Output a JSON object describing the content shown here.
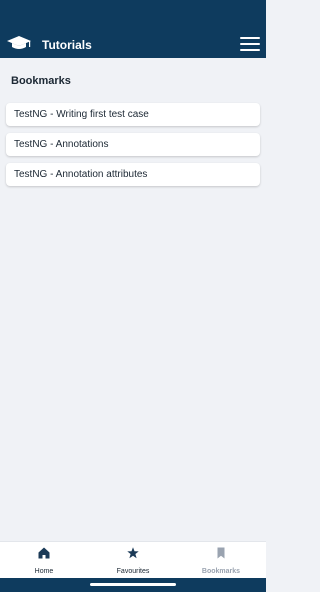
{
  "header": {
    "title": "Tutorials"
  },
  "page": {
    "title": "Bookmarks"
  },
  "bookmarks": [
    "TestNG - Writing first test case",
    "TestNG - Annotations",
    "TestNG - Annotation attributes"
  ],
  "nav": {
    "items": [
      {
        "label": "Home",
        "icon": "home-icon"
      },
      {
        "label": "Favourites",
        "icon": "star-icon"
      },
      {
        "label": "Bookmarks",
        "icon": "bookmark-icon",
        "active": true
      }
    ]
  },
  "colors": {
    "header": "#0e3b5e",
    "background": "#f0f2f6",
    "text": "#1b2733",
    "inactive_nav": "#9aa3b0"
  }
}
